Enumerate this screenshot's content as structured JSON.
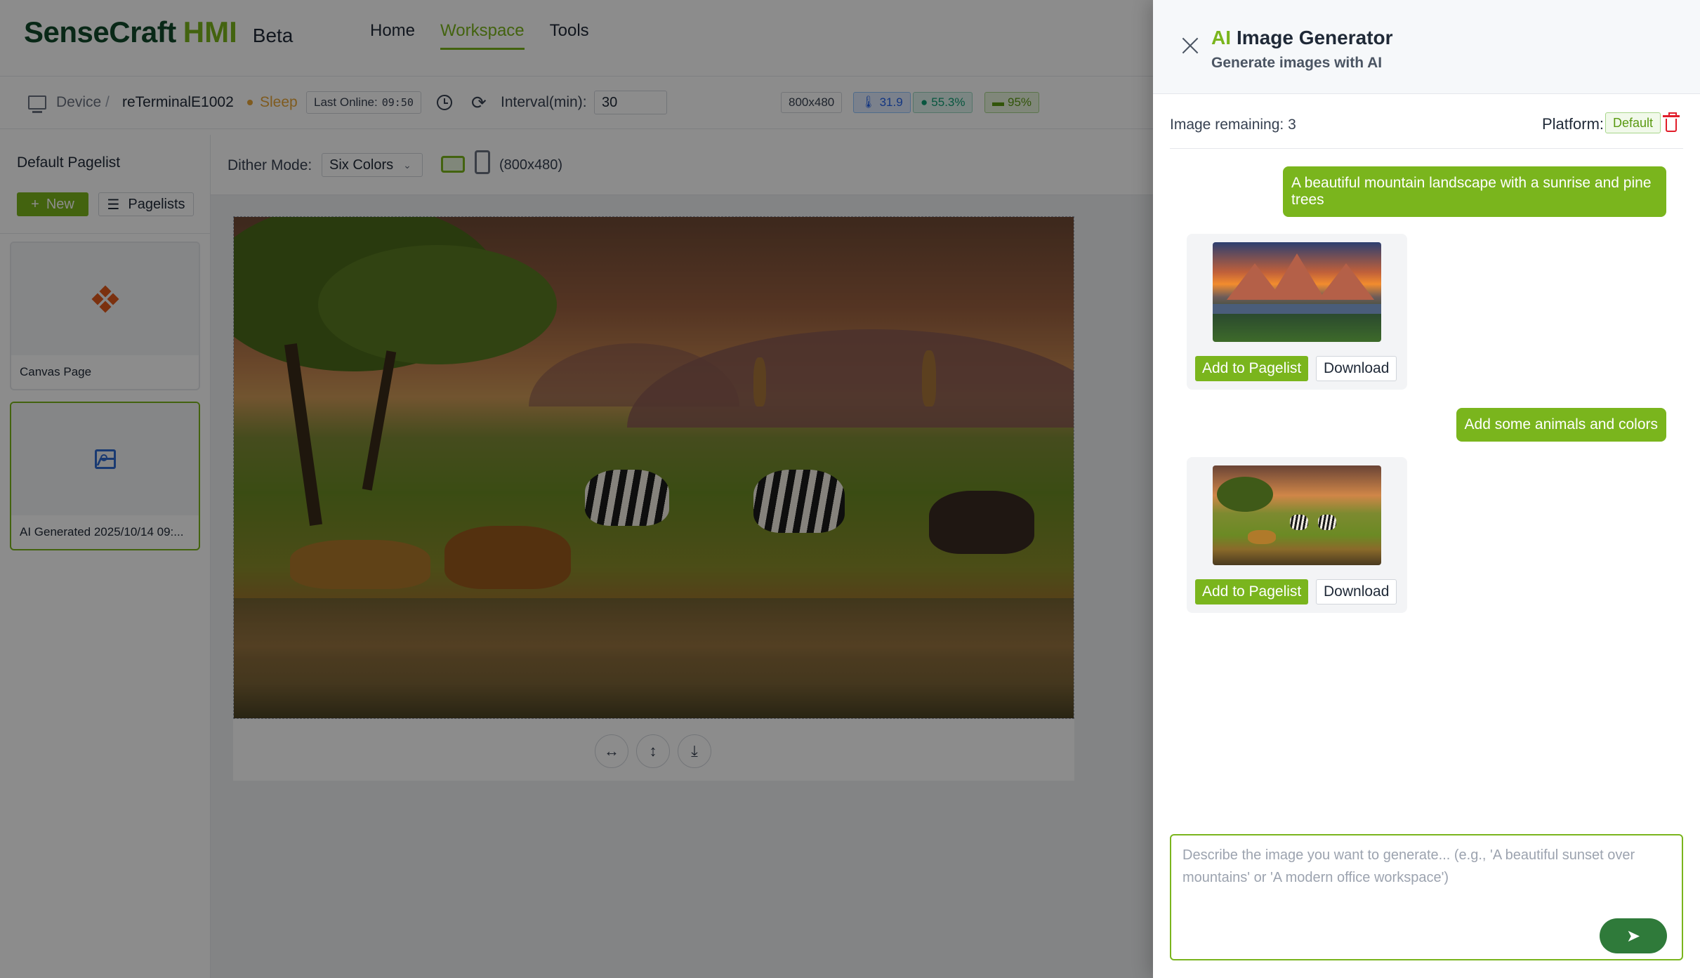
{
  "brand": {
    "name": "SenseCraft",
    "suffix": "HMI",
    "tag": "Beta"
  },
  "nav": [
    {
      "label": "Home"
    },
    {
      "label": "Workspace",
      "active": true
    },
    {
      "label": "Tools"
    }
  ],
  "device_bar": {
    "crumb_root": "Device",
    "crumb_sep": "/",
    "device_name": "reTerminalE1002",
    "status": "Sleep",
    "last_online_label": "Last Online:",
    "last_online_time": "09:50",
    "interval_label": "Interval(min):",
    "interval_value": "30",
    "resolution": "800x480",
    "temperature": "31.9",
    "humidity": "55.3%",
    "battery": "95%"
  },
  "sidebar": {
    "title": "Default Pagelist",
    "new_label": "New",
    "pagelists_label": "Pagelists",
    "pages": [
      {
        "label": "Canvas Page",
        "icon": "diamond-icon"
      },
      {
        "label": "AI Generated 2025/10/14 09:...",
        "icon": "image-icon",
        "selected": true
      }
    ]
  },
  "toolbar": {
    "dither_label": "Dither Mode:",
    "dither_value": "Six Colors",
    "dims": "(800x480)"
  },
  "canvas_tools": [
    "fit-width-icon",
    "fit-height-icon",
    "download-icon"
  ],
  "drawer": {
    "title_accent": "AI",
    "title_rest": "Image Generator",
    "subtitle": "Generate images with AI",
    "remaining_label": "Image remaining: 3",
    "platform_label": "Platform:",
    "platform_value": "Default",
    "messages": [
      {
        "role": "user",
        "text": "A beautiful mountain landscape with a sunrise and pine trees"
      },
      {
        "role": "ai",
        "add_label": "Add to Pagelist",
        "download_label": "Download"
      },
      {
        "role": "user",
        "text": "Add some animals and colors"
      },
      {
        "role": "ai",
        "add_label": "Add to Pagelist",
        "download_label": "Download"
      }
    ],
    "prompt_placeholder": "Describe the image you want to generate... (e.g., 'A beautiful sunset over mountains' or 'A modern office workspace')"
  },
  "colors": {
    "accent": "#7ab51d",
    "brand_dark": "#114a2b",
    "status_sleep": "#e8a63a",
    "danger": "#e11d2a"
  }
}
